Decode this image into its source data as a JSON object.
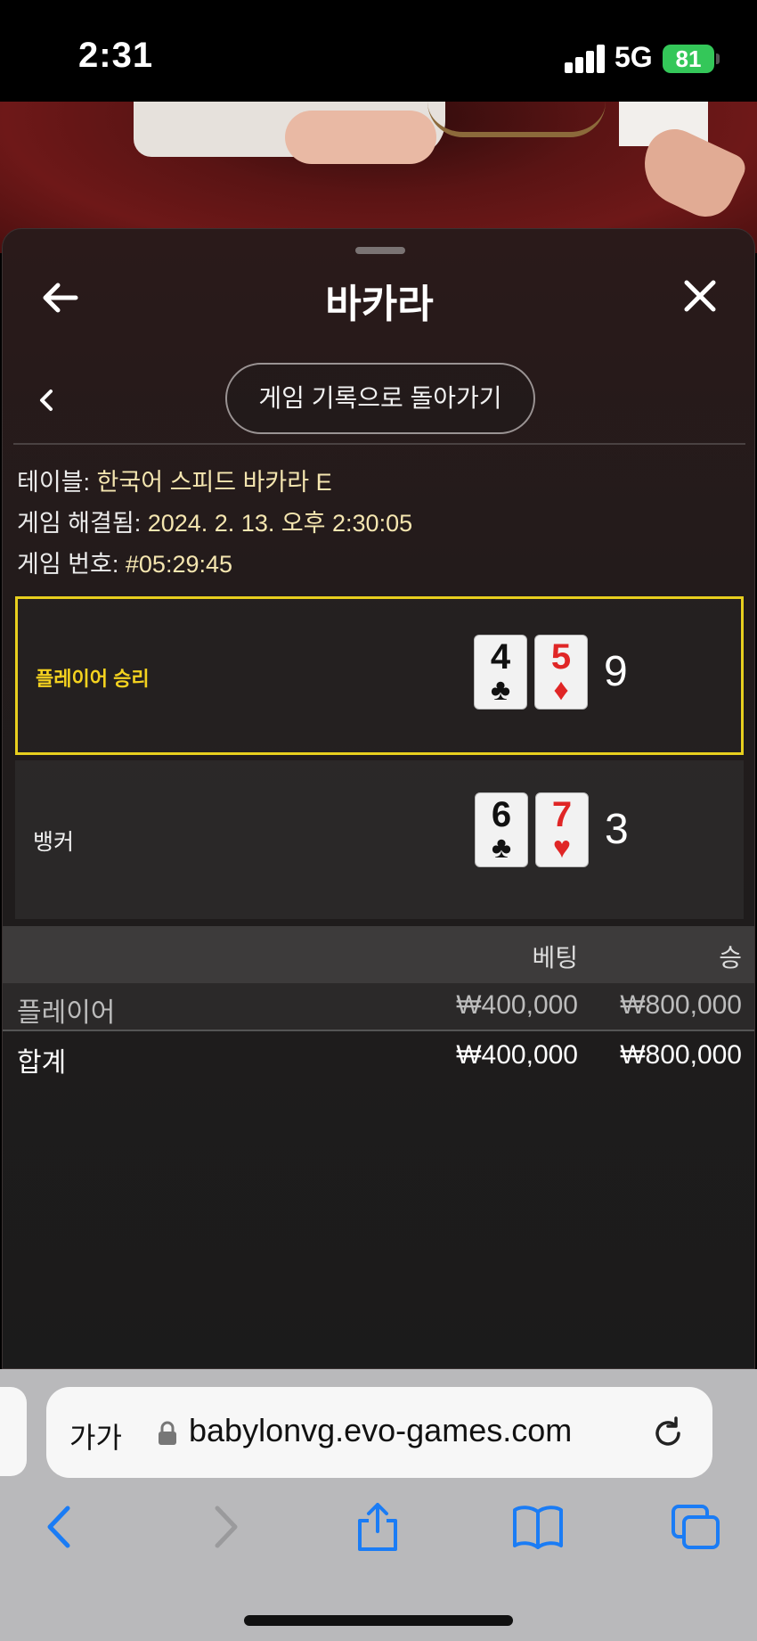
{
  "status_bar": {
    "time": "2:31",
    "network": "5G",
    "battery": "81"
  },
  "panel": {
    "title": "바카라",
    "history_button": "게임 기록으로 돌아가기",
    "info": {
      "table_label": "테이블:",
      "table_value": "한국어 스피드 바카라 E",
      "resolved_label": "게임 해결됨:",
      "resolved_value": "2024. 2. 13. 오후 2:30:05",
      "number_label": "게임 번호:",
      "number_value": "#05:29:45"
    },
    "player": {
      "label": "플레이어 승리",
      "cards": [
        {
          "rank": "4",
          "suit": "♣",
          "color": "black"
        },
        {
          "rank": "5",
          "suit": "♦",
          "color": "red"
        }
      ],
      "score": "9"
    },
    "banker": {
      "label": "뱅커",
      "cards": [
        {
          "rank": "6",
          "suit": "♣",
          "color": "black"
        },
        {
          "rank": "7",
          "suit": "♥",
          "color": "red"
        }
      ],
      "score": "3"
    },
    "bets": {
      "headers": {
        "bet": "베팅",
        "win": "승"
      },
      "rows": [
        {
          "name": "플레이어",
          "bet": "₩400,000",
          "win": "₩800,000"
        },
        {
          "name": "합계",
          "bet": "₩400,000",
          "win": "₩800,000"
        }
      ]
    }
  },
  "browser": {
    "text_size_label": "가가",
    "url": "babylonvg.evo-games.com"
  },
  "colors": {
    "accent_yellow": "#e8cf1e",
    "battery_green": "#34c759",
    "ios_blue": "#1a7cf5"
  }
}
